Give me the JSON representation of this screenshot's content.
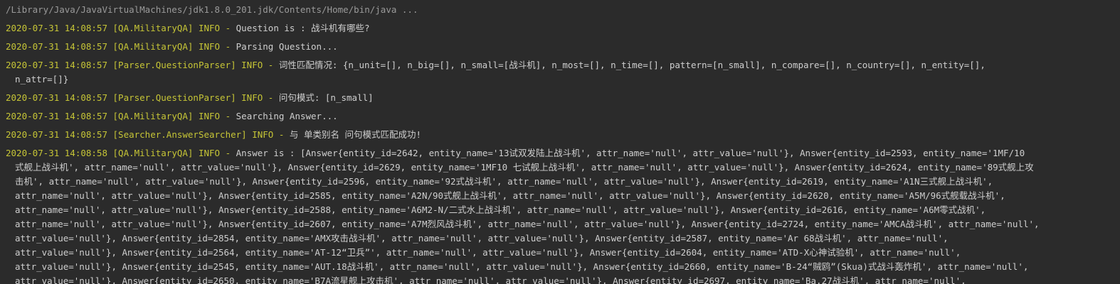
{
  "command": "/Library/Java/JavaVirtualMachines/jdk1.8.0_201.jdk/Contents/Home/bin/java ...",
  "logs": [
    {
      "ts": "2020-07-31 14:08:57",
      "src": "[QA.MilitaryQA]",
      "lvl": "INFO",
      "sep": "-",
      "msg": "Question is : 战斗机有哪些?",
      "cont": []
    },
    {
      "ts": "2020-07-31 14:08:57",
      "src": "[QA.MilitaryQA]",
      "lvl": "INFO",
      "sep": "-",
      "msg": "Parsing Question...",
      "cont": []
    },
    {
      "ts": "2020-07-31 14:08:57",
      "src": "[Parser.QuestionParser]",
      "lvl": "INFO",
      "sep": "-",
      "msg": "词性匹配情况: {n_unit=[], n_big=[], n_small=[战斗机], n_most=[], n_time=[], pattern=[n_small], n_compare=[], n_country=[], n_entity=[],",
      "cont": [
        "n_attr=[]}"
      ]
    },
    {
      "ts": "2020-07-31 14:08:57",
      "src": "[Parser.QuestionParser]",
      "lvl": "INFO",
      "sep": "-",
      "msg": "问句模式: [n_small]",
      "cont": []
    },
    {
      "ts": "2020-07-31 14:08:57",
      "src": "[QA.MilitaryQA]",
      "lvl": "INFO",
      "sep": "-",
      "msg": "Searching Answer...",
      "cont": []
    },
    {
      "ts": "2020-07-31 14:08:57",
      "src": "[Searcher.AnswerSearcher]",
      "lvl": "INFO",
      "sep": "-",
      "msg": "与 单类别名 问句模式匹配成功!",
      "cont": []
    },
    {
      "ts": "2020-07-31 14:08:58",
      "src": "[QA.MilitaryQA]",
      "lvl": "INFO",
      "sep": "-",
      "msg": "Answer is : [Answer{entity_id=2642, entity_name='13试双发陆上战斗机', attr_name='null', attr_value='null'}, Answer{entity_id=2593, entity_name='1MF/10",
      "cont": [
        "式舰上战斗机', attr_name='null', attr_value='null'}, Answer{entity_id=2629, entity_name='1MF10 七试舰上战斗机', attr_name='null', attr_value='null'}, Answer{entity_id=2624, entity_name='89式舰上攻",
        "击机', attr_name='null', attr_value='null'}, Answer{entity_id=2596, entity_name='92式战斗机', attr_name='null', attr_value='null'}, Answer{entity_id=2619, entity_name='A1N三式舰上战斗机',",
        "attr_name='null', attr_value='null'}, Answer{entity_id=2585, entity_name='A2N/90式舰上战斗机', attr_name='null', attr_value='null'}, Answer{entity_id=2620, entity_name='A5M/96式舰载战斗机',",
        "attr_name='null', attr_value='null'}, Answer{entity_id=2588, entity_name='A6M2-N/二式水上战斗机', attr_name='null', attr_value='null'}, Answer{entity_id=2616, entity_name='A6M零式战机',",
        "attr_name='null', attr_value='null'}, Answer{entity_id=2607, entity_name='A7M烈风战斗机', attr_name='null', attr_value='null'}, Answer{entity_id=2724, entity_name='AMCA战斗机', attr_name='null',",
        " attr_value='null'}, Answer{entity_id=2854, entity_name='AMX攻击战斗机', attr_name='null', attr_value='null'}, Answer{entity_id=2587, entity_name='Ar 68战斗机', attr_name='null',",
        "attr_value='null'}, Answer{entity_id=2564, entity_name='AT-12“卫兵”', attr_name='null', attr_value='null'}, Answer{entity_id=2604, entity_name='ATD-X心神试验机', attr_name='null',",
        "attr_value='null'}, Answer{entity_id=2545, entity_name='AUT.18战斗机', attr_name='null', attr_value='null'}, Answer{entity_id=2660, entity_name='B-24“贼鸥”(Skua)式战斗轰炸机', attr_name='null',",
        "attr_value='null'}, Answer{entity_id=2650, entity_name='B7A流星舰上攻击机', attr_name='null', attr_value='null'}, Answer{entity_id=2697, entity_name='Ba.27战斗机', attr_name='null',"
      ]
    }
  ]
}
